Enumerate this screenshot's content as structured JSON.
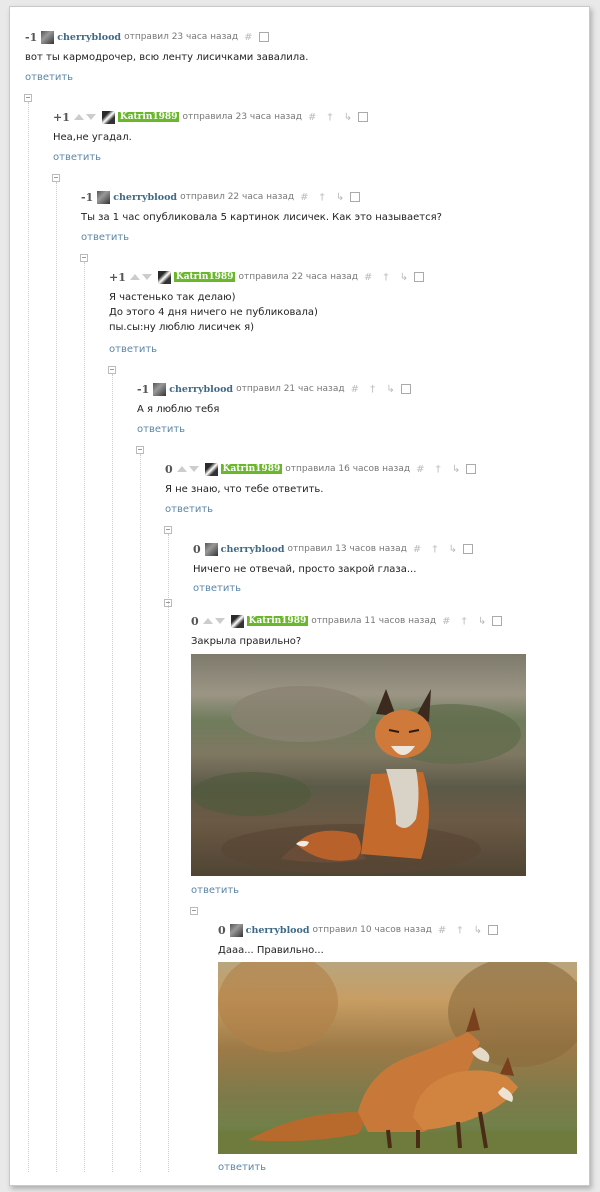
{
  "reply_label": "ответить",
  "comments": [
    {
      "rating": "-1",
      "author": "cherryblood",
      "time": "отправил 23 часа назад",
      "text": [
        "вот ты кармодрочер, всю ленту лисичками завалила."
      ]
    },
    {
      "rating": "+1",
      "author": "Katrin1989",
      "time": "отправила 23 часа назад",
      "text": [
        "Неа,не угадал."
      ]
    },
    {
      "rating": "-1",
      "author": "cherryblood",
      "time": "отправил 22 часа назад",
      "text": [
        "Ты за 1 час опубликовала 5 картинок лисичек. Как это называется?"
      ]
    },
    {
      "rating": "+1",
      "author": "Katrin1989",
      "time": "отправила 22 часа назад",
      "text": [
        "Я частенько так делаю)",
        "До этого 4 дня ничего не публиковала)",
        "пы.сы:ну люблю лисичек я)"
      ]
    },
    {
      "rating": "-1",
      "author": "cherryblood",
      "time": "отправил 21 час назад",
      "text": [
        "А я люблю тебя"
      ]
    },
    {
      "rating": "0",
      "author": "Katrin1989",
      "time": "отправила 16 часов назад",
      "text": [
        "Я не знаю, что тебе ответить."
      ]
    },
    {
      "rating": "0",
      "author": "cherryblood",
      "time": "отправил 13 часов назад",
      "text": [
        "Ничего не отвечай, просто закрой глаза..."
      ]
    },
    {
      "rating": "0",
      "author": "Katrin1989",
      "time": "отправила 11 часов назад",
      "text": [
        "Закрыла правильно?"
      ]
    },
    {
      "rating": "0",
      "author": "cherryblood",
      "time": "отправил 10 часов назад",
      "text": [
        "Дааа... Правильно..."
      ]
    }
  ],
  "colors": {
    "author_link": "#3e6a87",
    "author_badge": "#6ab72c",
    "reply_link": "#5b86a7"
  },
  "icons": [
    "vote-up-arrow-icon",
    "vote-down-arrow-icon",
    "link-hash-icon",
    "parent-comment-icon",
    "thread-icon",
    "save-icon"
  ]
}
